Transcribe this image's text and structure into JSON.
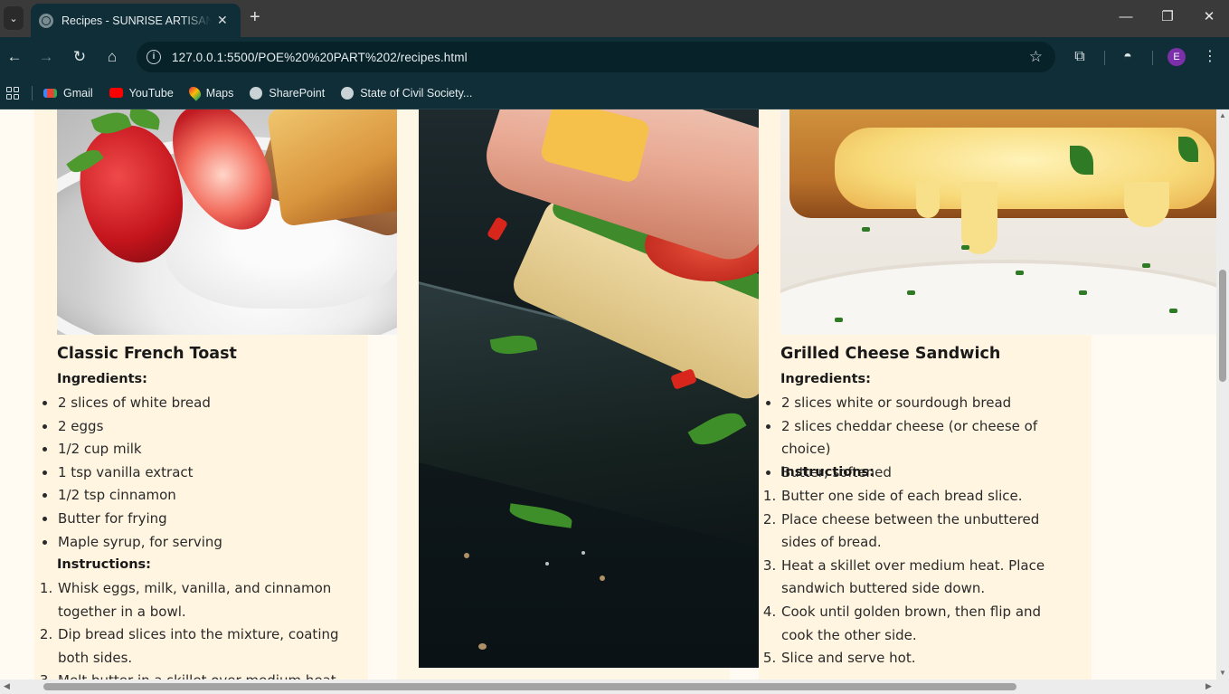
{
  "browser": {
    "tab_title": "Recipes - SUNRISE ARTISAN BAKERY",
    "url": "127.0.0.1:5500/POE%20%20PART%202/recipes.html",
    "profile_initial": "E",
    "bookmarks": [
      {
        "label": "Gmail",
        "icon": "gmail-icon",
        "color": "#ea4335"
      },
      {
        "label": "YouTube",
        "icon": "youtube-icon",
        "color": "#ff0000"
      },
      {
        "label": "Maps",
        "icon": "maps-icon",
        "color": "#34a853"
      },
      {
        "label": "SharePoint",
        "icon": "globe-icon",
        "color": "#c9d3d6"
      },
      {
        "label": "State of Civil Society...",
        "icon": "globe-icon",
        "color": "#c9d3d6"
      }
    ]
  },
  "colors": {
    "page_background": "#fffbf3",
    "card_background": "#fff5e1",
    "browser_chrome": "#0f2e37",
    "avatar": "#7b2fa8"
  },
  "recipes": [
    {
      "title": "Classic French Toast",
      "ingredients_label": "Ingredients:",
      "ingredients": [
        "2 slices of white bread",
        "2 eggs",
        "1/2 cup milk",
        "1 tsp vanilla extract",
        "1/2 tsp cinnamon",
        "Butter for frying",
        "Maple syrup, for serving"
      ],
      "instructions_label": "Instructions:",
      "instructions": [
        "Whisk eggs, milk, vanilla, and cinnamon together in a bowl.",
        "Dip bread slices into the mixture, coating both sides.",
        "Melt butter in a skillet over medium heat."
      ]
    },
    {
      "title": "Grilled Cheese Sandwich",
      "ingredients_label": "Ingredients:",
      "ingredients": [
        "2 slices white or sourdough bread",
        "2 slices cheddar cheese (or cheese of choice)",
        "Butter, softened"
      ],
      "instructions_label": "Instructions:",
      "instructions": [
        "Butter one side of each bread slice.",
        "Place cheese between the unbuttered sides of bread.",
        "Heat a skillet over medium heat. Place sandwich buttered side down.",
        "Cook until golden brown, then flip and cook the other side.",
        "Slice and serve hot."
      ]
    }
  ]
}
